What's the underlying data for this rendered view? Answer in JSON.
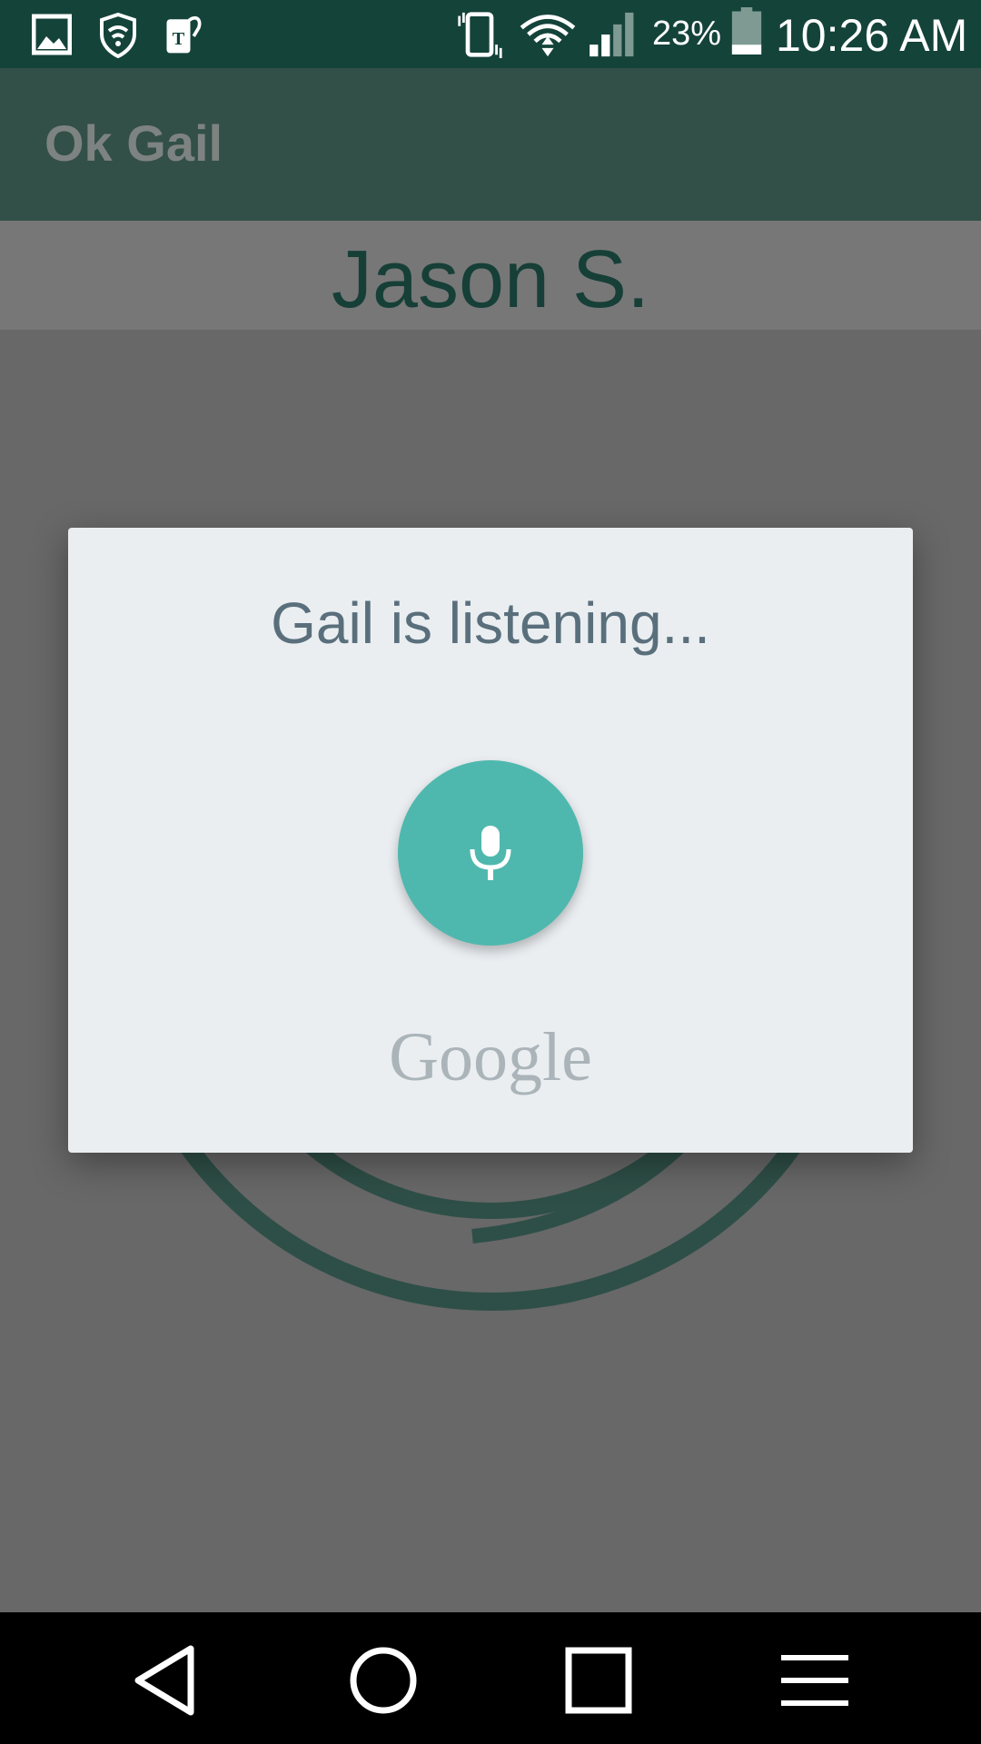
{
  "status_bar": {
    "battery_percent_text": "23%",
    "battery_level": 0.23,
    "time": "10:26 AM",
    "icons": [
      "gallery-icon",
      "lookout-shield-icon",
      "tmobile-tag-icon",
      "vibrate-icon",
      "wifi-icon",
      "cell-signal-icon",
      "battery-icon"
    ]
  },
  "app_bar": {
    "title": "Ok Gail"
  },
  "contact": {
    "name": "Jason S."
  },
  "dialog": {
    "title": "Gail is listening...",
    "mic_icon": "microphone-icon",
    "brand": "Google"
  },
  "nav_bar": {
    "icons": [
      "back-icon",
      "home-icon",
      "recents-icon",
      "menu-icon"
    ]
  },
  "colors": {
    "status_bar": "#14433a",
    "app_bar": "#324f48",
    "accent_mic": "#4fb8ae",
    "dialog_bg": "#eaeef1",
    "ring": "#2e4f47"
  }
}
